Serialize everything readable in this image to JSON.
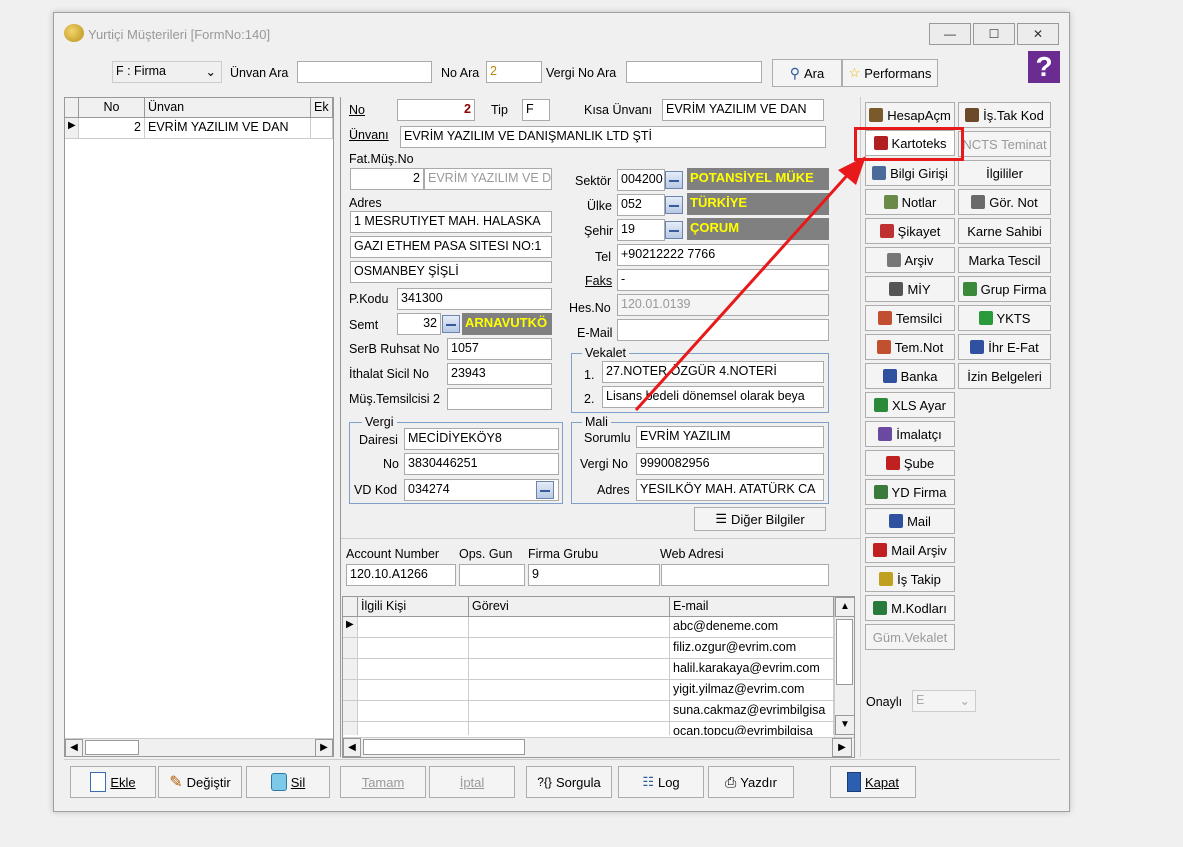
{
  "window": {
    "title": "Yurtiçi Müşterileri [FormNo:140]",
    "minimize": "—",
    "maximize": "☐",
    "close": "✕",
    "help": "?"
  },
  "search": {
    "type_value": "F : Firma",
    "unvan_label": "Ünvan Ara",
    "unvan_value": "",
    "no_label": "No Ara",
    "no_value": "2",
    "vergi_label": "Vergi No Ara",
    "vergi_value": "",
    "ara_button": "Ara",
    "performans_button": "Performans"
  },
  "list": {
    "headers": [
      "No",
      "Ünvan",
      "Ek"
    ],
    "rows": [
      {
        "no": "2",
        "unvan": "EVRİM YAZILIM VE DAN"
      }
    ]
  },
  "form": {
    "no_label": "No",
    "no_value": "2",
    "tip_label": "Tip",
    "tip_value": "F",
    "kisa_label": "Kısa Ünvanı",
    "kisa_value": "EVRİM YAZILIM VE DAN",
    "unvan_label": "Ünvanı",
    "unvan_value": "EVRİM YAZILIM VE DANIŞMANLIK LTD ŞTİ",
    "fatmus_label": "Fat.Müş.No",
    "fatmus_no": "2",
    "fatmus_name": "EVRİM YAZILIM VE D",
    "adres_label": "Adres",
    "adres1": "1 MESRUTIYET MAH. HALASKA",
    "adres2": "GAZI ETHEM PASA SITESI NO:1",
    "adres3": "OSMANBEY ŞİŞLİ",
    "pkodu_label": "P.Kodu",
    "pkodu_value": "341300",
    "semt_label": "Semt",
    "semt_code": "32",
    "semt_name": "ARNAVUTKÖ",
    "serb_label": "SerB Ruhsat No",
    "serb_value": "1057",
    "ithalat_label": "İthalat Sicil No",
    "ithalat_value": "23943",
    "temsilci_label": "Müş.Temsilcisi 2",
    "temsilci_value": "",
    "sektor_label": "Sektör",
    "sektor_code": "004200",
    "sektor_name": "POTANSİYEL MÜKE",
    "ulke_label": "Ülke",
    "ulke_code": "052",
    "ulke_name": "TÜRKİYE",
    "sehir_label": "Şehir",
    "sehir_code": "19",
    "sehir_name": "ÇORUM",
    "tel_label": "Tel",
    "tel_value": "+90212222 7766",
    "faks_label": "Faks",
    "faks_value": "-",
    "hes_label": "Hes.No",
    "hes_value": "120.01.0139",
    "email_label": "E-Mail",
    "email_value": "",
    "vekalet_title": "Vekalet",
    "vek1_no": "1.",
    "vek1": "27.NOTER ÖZGÜR 4.NOTERİ",
    "vek2_no": "2.",
    "vek2": "Lisans bedeli dönemsel olarak beya",
    "vergi_title": "Vergi",
    "vd_label": "Dairesi",
    "vd_value": "MECİDİYEKÖY8",
    "vno_label": "No",
    "vno_value": "3830446251",
    "vdkod_label": "VD Kod",
    "vdkod_value": "034274",
    "mali_title": "Mali",
    "sorumlu_label": "Sorumlu",
    "sorumlu_value": "EVRİM YAZILIM",
    "mvergi_label": "Vergi No",
    "mvergi_value": "9990082956",
    "madres_label": "Adres",
    "madres_value": "YESILKÖY MAH. ATATÜRK CA",
    "diger_button": "Diğer Bilgiler",
    "account_label": "Account Number",
    "account_value": "120.10.A1266",
    "ops_label": "Ops. Gun",
    "ops_value": "",
    "grup_label": "Firma Grubu",
    "grup_value": "9",
    "web_label": "Web Adresi",
    "web_value": ""
  },
  "contacts": {
    "headers": [
      "İlgili Kişi",
      "Görevi",
      "E-mail"
    ],
    "rows": [
      {
        "kisi": "",
        "gorev": "",
        "email": "abc@deneme.com"
      },
      {
        "kisi": "",
        "gorev": "",
        "email": "filiz.ozgur@evrim.com"
      },
      {
        "kisi": "",
        "gorev": "",
        "email": "halil.karakaya@evrim.com"
      },
      {
        "kisi": "",
        "gorev": "",
        "email": "yigit.yilmaz@evrim.com"
      },
      {
        "kisi": "",
        "gorev": "",
        "email": "suna.cakmaz@evrimbilgisa"
      },
      {
        "kisi": "",
        "gorev": "",
        "email": "ocan.topcu@evrimbilgisa"
      }
    ]
  },
  "side": {
    "col1": [
      "HesapAçm",
      "Kartoteks",
      "Bilgi Girişi",
      "Notlar",
      "Şikayet",
      "Arşiv",
      "MİY",
      "Temsilci",
      "Tem.Not",
      "Banka",
      "XLS Ayar",
      "İmalatçı",
      "Şube",
      "YD Firma",
      "Mail",
      "Mail Arşiv",
      "İş Takip",
      "M.Kodları",
      "Güm.Vekalet"
    ],
    "col2": [
      "İş.Tak Kod",
      "NCTS Teminat",
      "İlgililer",
      "Gör. Not",
      "Karne Sahibi",
      "Marka Tescil",
      "Grup Firma",
      "YKTS",
      "İhr E-Fat",
      "İzin Belgeleri"
    ],
    "onayli_label": "Onaylı",
    "onayli_value": "E"
  },
  "bottom": {
    "ekle": "Ekle",
    "degistir": "Değiştir",
    "sil": "Sil",
    "tamam": "Tamam",
    "iptal": "İptal",
    "sorgula": "Sorgula",
    "log": "Log",
    "yazdir": "Yazdır",
    "kapat": "Kapat"
  },
  "colors": {
    "highlight": "#e8191a",
    "yellow_text": "#ffff00",
    "gray_fill": "#808080"
  }
}
